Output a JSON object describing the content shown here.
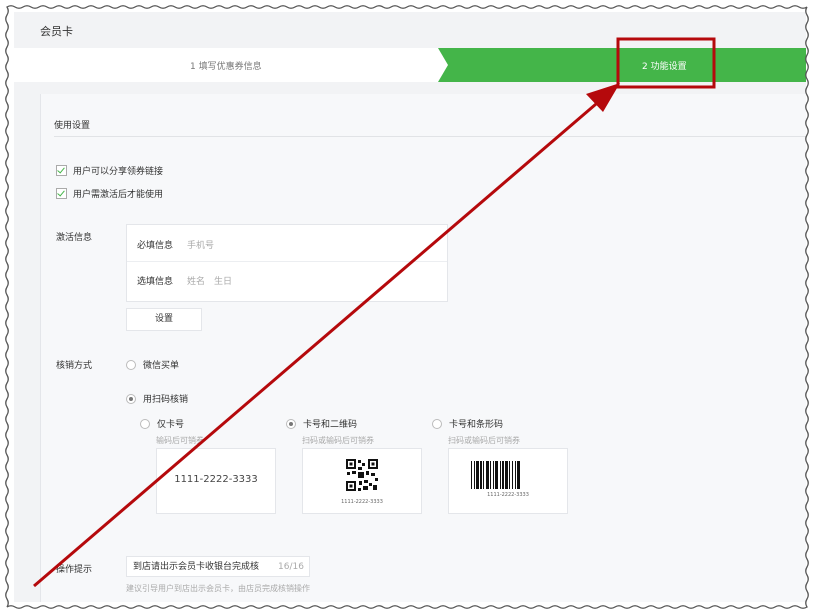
{
  "header": {
    "title": "会员卡"
  },
  "steps": [
    {
      "label": "1 填写优惠券信息"
    },
    {
      "label": "2 功能设置"
    }
  ],
  "usage": {
    "section_title": "使用设置",
    "checkboxes": [
      {
        "label": "用户可以分享领券链接",
        "checked": true
      },
      {
        "label": "用户需激活后才能使用",
        "checked": true
      }
    ]
  },
  "activation": {
    "label": "激活信息",
    "required_label": "必填信息",
    "required_fields": "手机号",
    "optional_label": "选填信息",
    "optional_fields": "姓名　生日",
    "settings_button": "设置"
  },
  "redeem": {
    "label": "核销方式",
    "options": [
      {
        "label": "微信买单",
        "selected": false
      },
      {
        "label": "用扫码核销",
        "selected": true
      }
    ],
    "sub_options": [
      {
        "label": "仅卡号",
        "hint": "输码后可销券",
        "preview_text": "1111-2222-3333",
        "selected": false
      },
      {
        "label": "卡号和二维码",
        "hint": "扫码或输码后可销券",
        "preview_text": "1111-2222-3333",
        "selected": true
      },
      {
        "label": "卡号和条形码",
        "hint": "扫码或输码后可销券",
        "preview_text": "1111-2222-3333",
        "selected": false
      }
    ]
  },
  "tip": {
    "label": "操作提示",
    "value": "到店请出示会员卡收银台完成核",
    "count": "16/16",
    "hint": "建议引导用户到店出示会员卡，由店员完成核销操作"
  },
  "colors": {
    "accent_green": "#44b549",
    "annotation_red": "#b5090c"
  }
}
